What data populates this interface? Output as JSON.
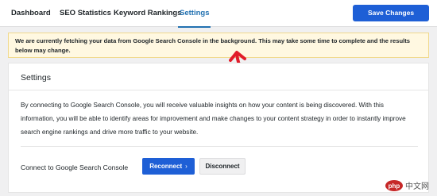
{
  "tabs": [
    {
      "label": "Dashboard"
    },
    {
      "label": "SEO Statistics"
    },
    {
      "label": "Keyword Rankings"
    },
    {
      "label": "Settings",
      "active": true
    }
  ],
  "toolbar": {
    "save_label": "Save Changes"
  },
  "notice": {
    "text": "We are currently fetching your data from Google Search Console in the background. This may take some time to complete and the results below may change."
  },
  "card": {
    "title": "Settings",
    "description": "By connecting to Google Search Console, you will receive valuable insights on how your content is being discovered. With this information, you will be able to identify areas for improvement and make changes to your content strategy in order to instantly improve search engine rankings and drive more traffic to your website.",
    "connect_label": "Connect to Google Search Console",
    "reconnect_label": "Reconnect",
    "reconnect_icon": "›",
    "disconnect_label": "Disconnect"
  },
  "watermark": {
    "text": "php 中文网"
  },
  "colors": {
    "accent": "#1e5fd6",
    "active_tab": "#2271b1",
    "notice_bg": "#fff8e1",
    "annotation": "#e11d2a"
  }
}
